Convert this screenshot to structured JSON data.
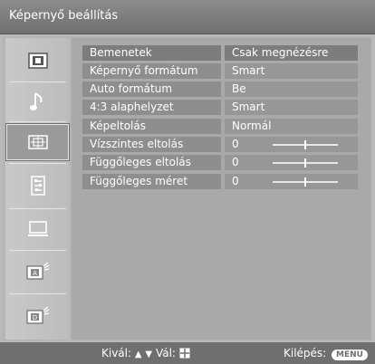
{
  "window": {
    "title": "Képernyő beállítás"
  },
  "sidebar": {
    "items": [
      {
        "icon": "picture-icon",
        "selected": false
      },
      {
        "icon": "music-note-icon",
        "selected": false
      },
      {
        "icon": "screen-position-icon",
        "selected": true
      },
      {
        "icon": "settings-list-icon",
        "selected": false
      },
      {
        "icon": "pc-monitor-icon",
        "selected": false
      },
      {
        "icon": "analog-channel-icon",
        "selected": false
      },
      {
        "icon": "digital-channel-icon",
        "selected": false
      }
    ]
  },
  "settings": [
    {
      "label": "Bemenetek",
      "value": "Csak megnézésre"
    },
    {
      "label": "Képernyő formátum",
      "value": "Smart"
    },
    {
      "label": "Auto formátum",
      "value": "Be"
    },
    {
      "label": "4:3 alaphelyzet",
      "value": "Smart"
    },
    {
      "label": "Képeltolás",
      "value": "Normál"
    },
    {
      "label": "Vízszintes eltolás",
      "value": "0",
      "slider": 0.5
    },
    {
      "label": "Függőleges eltolás",
      "value": "0",
      "slider": 0.5
    },
    {
      "label": "Függőleges méret",
      "value": "0",
      "slider": 0.5
    }
  ],
  "footer": {
    "select_label": "Kivál:",
    "confirm_label": "Vál:",
    "exit_label": "Kilépés:",
    "menu_button": "MENU"
  },
  "colors": {
    "title_bar": "#7d7d7d",
    "background": "#b4b4b4",
    "footer": "#6f6f6f",
    "text": "#ffffff"
  }
}
